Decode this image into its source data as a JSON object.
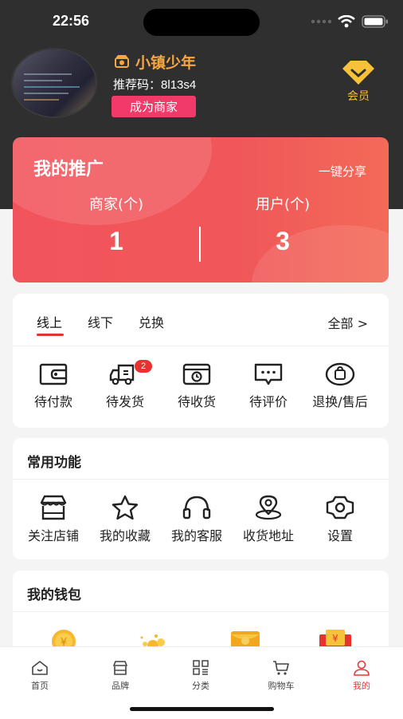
{
  "status": {
    "time": "22:56"
  },
  "profile": {
    "name": "小镇少年",
    "referral_label": "推荐码：",
    "referral_code": "8l13s4",
    "merchant_button": "成为商家",
    "vip_label": "会员"
  },
  "promo": {
    "title": "我的推广",
    "share": "一键分享",
    "stats": [
      {
        "label": "商家(个)",
        "value": "1"
      },
      {
        "label": "用户(个)",
        "value": "3"
      }
    ]
  },
  "orders": {
    "tabs": [
      "线上",
      "线下",
      "兑换"
    ],
    "active_tab": "线上",
    "all": "全部 >",
    "badge": "2",
    "items": [
      {
        "label": "待付款",
        "icon": "wallet-icon"
      },
      {
        "label": "待发货",
        "icon": "truck-icon"
      },
      {
        "label": "待收货",
        "icon": "box-icon"
      },
      {
        "label": "待评价",
        "icon": "comment-icon"
      },
      {
        "label": "退换/售后",
        "icon": "return-bag-icon"
      }
    ]
  },
  "functions": {
    "title": "常用功能",
    "items": [
      {
        "label": "关注店铺",
        "icon": "store-icon"
      },
      {
        "label": "我的收藏",
        "icon": "star-icon"
      },
      {
        "label": "我的客服",
        "icon": "headset-icon"
      },
      {
        "label": "收货地址",
        "icon": "location-icon"
      },
      {
        "label": "设置",
        "icon": "gear-icon"
      }
    ]
  },
  "wallet": {
    "title": "我的钱包"
  },
  "tabbar": {
    "items": [
      {
        "label": "首页",
        "icon": "home-icon"
      },
      {
        "label": "品牌",
        "icon": "brand-store-icon"
      },
      {
        "label": "分类",
        "icon": "category-icon"
      },
      {
        "label": "购物车",
        "icon": "cart-icon"
      },
      {
        "label": "我的",
        "icon": "user-icon"
      }
    ],
    "active": "我的"
  },
  "colors": {
    "accent": "#e4393c",
    "gold": "#f7c23a",
    "name": "#f5a742",
    "merchant_btn": "#f23a6a",
    "promo": "#f2545c"
  }
}
